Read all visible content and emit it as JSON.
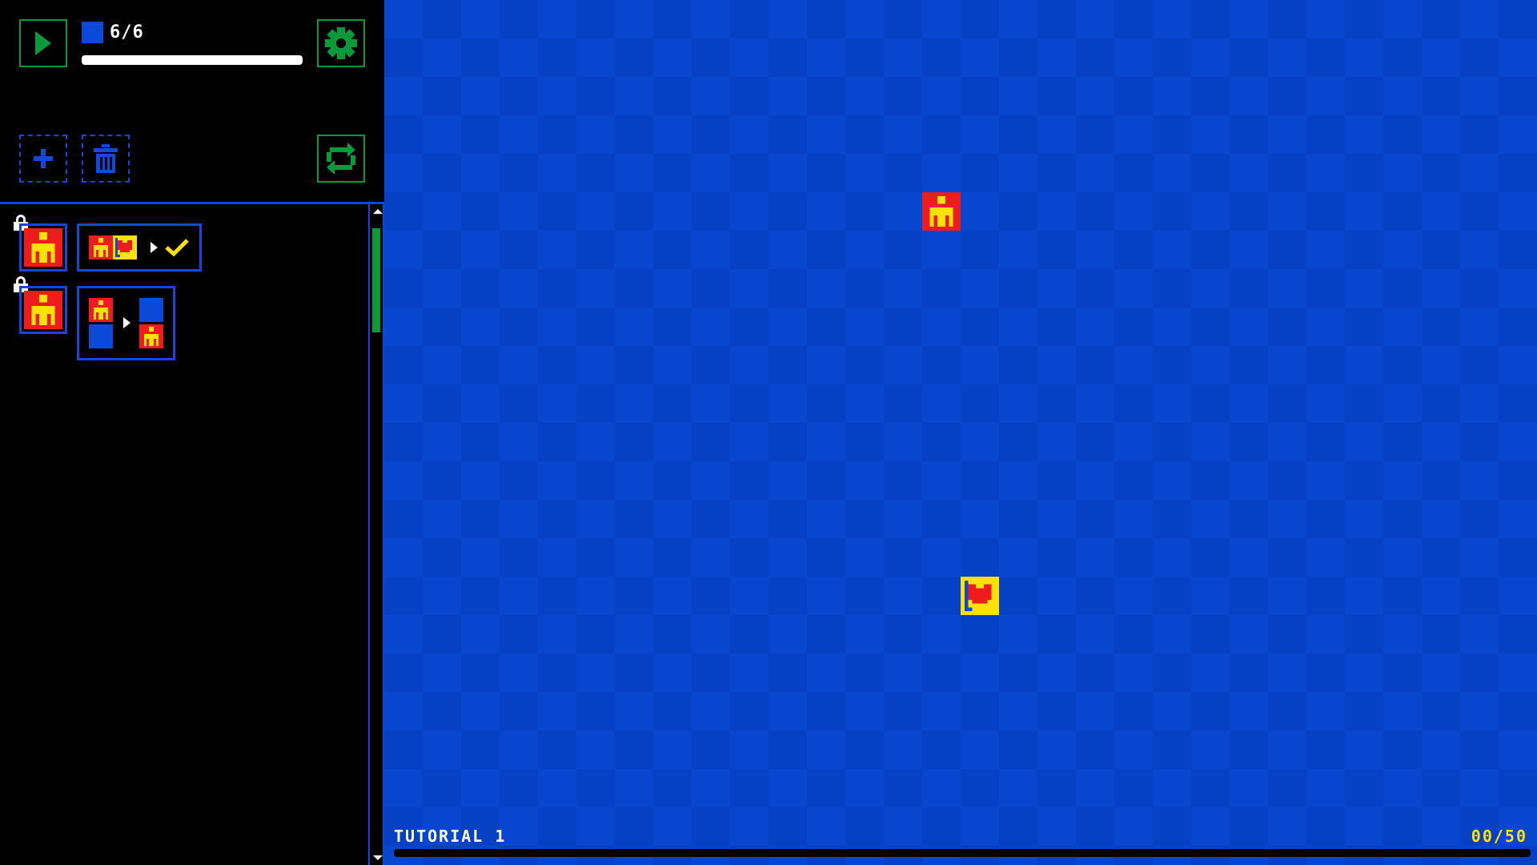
{
  "toolbar": {
    "play_icon": "play-icon",
    "settings_icon": "gear-icon",
    "add_icon": "plus-icon",
    "delete_icon": "trash-icon",
    "reset_icon": "refresh-icon"
  },
  "block_counter": {
    "text": "6/6",
    "progress": 1.0
  },
  "rules": [
    {
      "locked": true,
      "actor": "player",
      "condition": [
        "player",
        "flag"
      ],
      "result": "win-check"
    },
    {
      "locked": true,
      "actor": "player",
      "condition": "move-down",
      "result": "player-moves-down"
    }
  ],
  "level": {
    "name": "TUTORIAL 1",
    "moves": "00/50"
  },
  "colors": {
    "board_blue": "#0846cf",
    "player_red": "#ee1c1c",
    "player_yellow": "#ffe10a",
    "accent_green": "#0a9a3c",
    "border_blue": "#1448d8"
  }
}
